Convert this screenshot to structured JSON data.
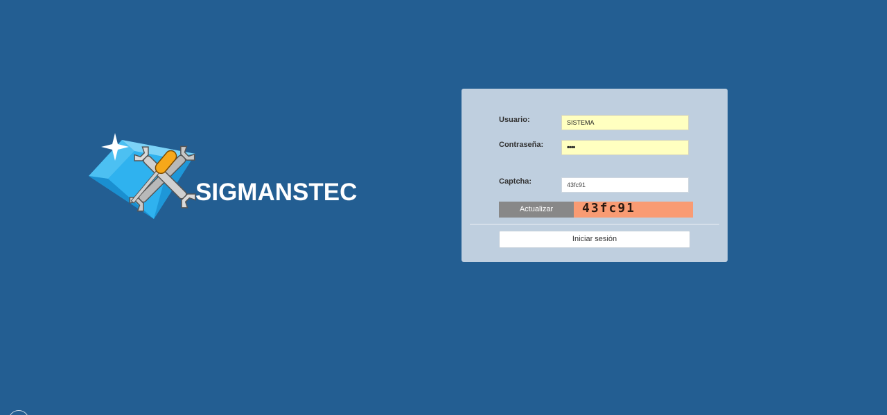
{
  "brand": {
    "name": "SIGMANSTEC"
  },
  "login": {
    "username_label": "Usuario:",
    "username_value": "SISTEMA",
    "password_label": "Contraseña:",
    "password_value": "••••",
    "captcha_label": "Captcha:",
    "captcha_value": "43fc91",
    "refresh_label": "Actualizar",
    "captcha_image_text": "43fc91",
    "submit_label": "Iniciar sesión"
  },
  "colors": {
    "background": "#235e92",
    "panel": "#bfcfdf",
    "input_autofill": "#ffffc0",
    "captcha_bg": "#f99b73",
    "refresh_button": "#888888"
  },
  "icons": {
    "logo": "diamond-tools-icon",
    "sparkle": "sparkle-icon"
  }
}
